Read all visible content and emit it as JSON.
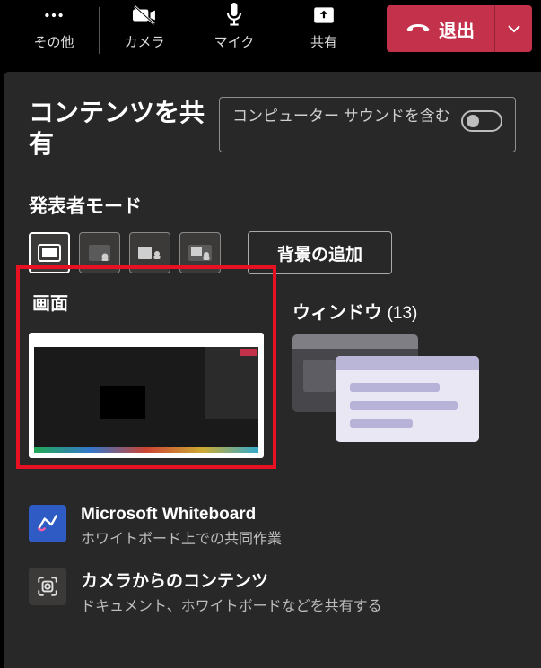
{
  "toolbar": {
    "more_label": "その他",
    "camera_label": "カメラ",
    "mic_label": "マイク",
    "share_label": "共有",
    "leave_label": "退出"
  },
  "panel": {
    "title": "コンテンツを共有",
    "include_sound_label": "コンピューター サウンドを含む",
    "presenter_mode_label": "発表者モード",
    "add_background_label": "背景の追加",
    "screen_label": "画面",
    "window_label": "ウィンドウ",
    "window_count": "(13)"
  },
  "share_options": {
    "whiteboard": {
      "title": "Microsoft Whiteboard",
      "subtitle": "ホワイトボード上での共同作業"
    },
    "camera_content": {
      "title": "カメラからのコンテンツ",
      "subtitle": "ドキュメント、ホワイトボードなどを共有する"
    }
  }
}
